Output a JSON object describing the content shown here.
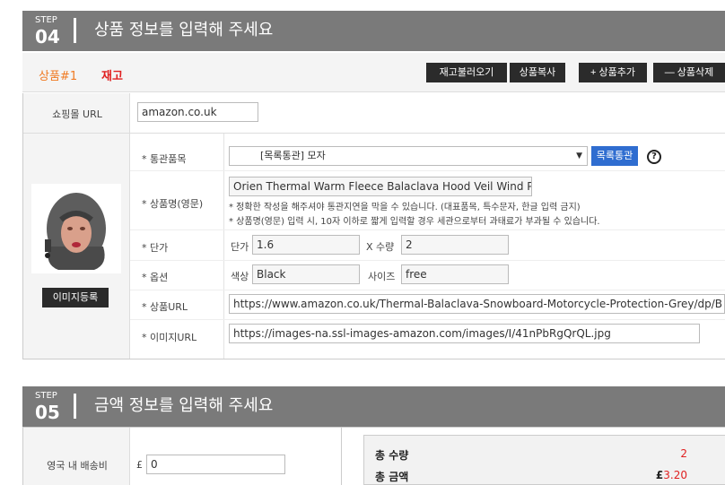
{
  "step4": {
    "label": "STEP",
    "number": "04",
    "title": "상품 정보를 입력해 주세요"
  },
  "item": {
    "label": "상품#1",
    "stock": "재고",
    "buttons": {
      "reload": "재고불러오기",
      "copy": "상품복사",
      "add": "+ 상품추가",
      "delete": "— 상품삭제"
    }
  },
  "shop": {
    "label": "쇼핑몰 URL",
    "value": "amazon.co.uk"
  },
  "customs": {
    "label": "* 통관품목",
    "selected": "[목록통관] 모자",
    "button": "목록통관",
    "help": "?"
  },
  "name": {
    "label": "* 상품명(영문)",
    "value": "Orien Thermal Warm Fleece Balaclava Hood Veil Wind Proo",
    "note1": "* 정확한 작성을 해주셔야 통관지연을 막을 수 있습니다. (대표품목, 특수문자, 한글 입력 금지)",
    "note2": "* 상품명(영문) 입력 시, 10자 이하로 짧게 입력할 경우 세관으로부터 과태료가 부과될 수 있습니다."
  },
  "price": {
    "label": "* 단가",
    "price_label": "단가",
    "price": "1.6",
    "qty_label": "X 수량",
    "qty": "2"
  },
  "option": {
    "label": "* 옵션",
    "color_label": "색상",
    "color": "Black",
    "size_label": "사이즈",
    "size": "free"
  },
  "product_url": {
    "label": "* 상품URL",
    "value": "https://www.amazon.co.uk/Thermal-Balaclava-Snowboard-Motorcycle-Protection-Grey/dp/B"
  },
  "image_url": {
    "label": "* 이미지URL",
    "value": "https://images-na.ssl-images-amazon.com/images/I/41nPbRgQrQL.jpg"
  },
  "image_button": "이미지등록",
  "step5": {
    "label": "STEP",
    "number": "05",
    "title": "금액 정보를 입력해 주세요"
  },
  "shipping": {
    "label": "영국 내 배송비",
    "currency": "£",
    "value": "0"
  },
  "summary": {
    "qty_label": "총 수량",
    "qty_value": "2",
    "amount_label": "총 금액",
    "amount_currency": "£",
    "amount_value": "3.20"
  },
  "colors": {
    "header_bg": "#7a7a7a",
    "accent_orange": "#f07a22",
    "accent_red": "#e02020",
    "button_blue": "#2f6dd0",
    "button_dark": "#2b2b2b"
  }
}
